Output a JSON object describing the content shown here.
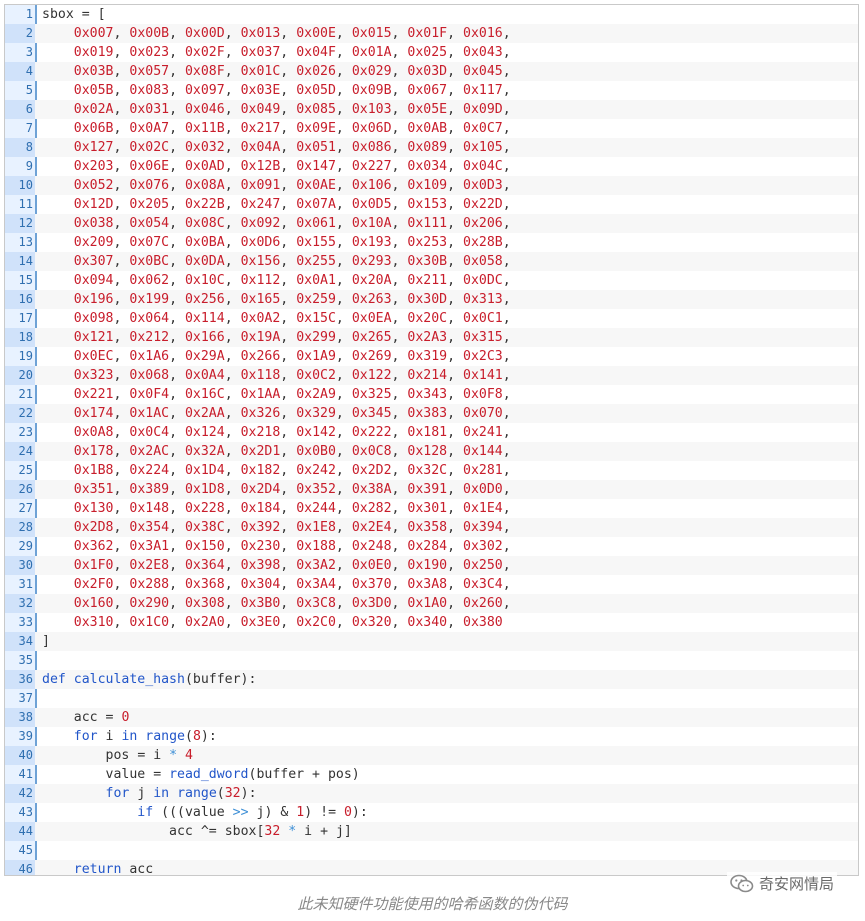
{
  "code_lines": [
    "sbox = [",
    "    0x007, 0x00B, 0x00D, 0x013, 0x00E, 0x015, 0x01F, 0x016,",
    "    0x019, 0x023, 0x02F, 0x037, 0x04F, 0x01A, 0x025, 0x043,",
    "    0x03B, 0x057, 0x08F, 0x01C, 0x026, 0x029, 0x03D, 0x045,",
    "    0x05B, 0x083, 0x097, 0x03E, 0x05D, 0x09B, 0x067, 0x117,",
    "    0x02A, 0x031, 0x046, 0x049, 0x085, 0x103, 0x05E, 0x09D,",
    "    0x06B, 0x0A7, 0x11B, 0x217, 0x09E, 0x06D, 0x0AB, 0x0C7,",
    "    0x127, 0x02C, 0x032, 0x04A, 0x051, 0x086, 0x089, 0x105,",
    "    0x203, 0x06E, 0x0AD, 0x12B, 0x147, 0x227, 0x034, 0x04C,",
    "    0x052, 0x076, 0x08A, 0x091, 0x0AE, 0x106, 0x109, 0x0D3,",
    "    0x12D, 0x205, 0x22B, 0x247, 0x07A, 0x0D5, 0x153, 0x22D,",
    "    0x038, 0x054, 0x08C, 0x092, 0x061, 0x10A, 0x111, 0x206,",
    "    0x209, 0x07C, 0x0BA, 0x0D6, 0x155, 0x193, 0x253, 0x28B,",
    "    0x307, 0x0BC, 0x0DA, 0x156, 0x255, 0x293, 0x30B, 0x058,",
    "    0x094, 0x062, 0x10C, 0x112, 0x0A1, 0x20A, 0x211, 0x0DC,",
    "    0x196, 0x199, 0x256, 0x165, 0x259, 0x263, 0x30D, 0x313,",
    "    0x098, 0x064, 0x114, 0x0A2, 0x15C, 0x0EA, 0x20C, 0x0C1,",
    "    0x121, 0x212, 0x166, 0x19A, 0x299, 0x265, 0x2A3, 0x315,",
    "    0x0EC, 0x1A6, 0x29A, 0x266, 0x1A9, 0x269, 0x319, 0x2C3,",
    "    0x323, 0x068, 0x0A4, 0x118, 0x0C2, 0x122, 0x214, 0x141,",
    "    0x221, 0x0F4, 0x16C, 0x1AA, 0x2A9, 0x325, 0x343, 0x0F8,",
    "    0x174, 0x1AC, 0x2AA, 0x326, 0x329, 0x345, 0x383, 0x070,",
    "    0x0A8, 0x0C4, 0x124, 0x218, 0x142, 0x222, 0x181, 0x241,",
    "    0x178, 0x2AC, 0x32A, 0x2D1, 0x0B0, 0x0C8, 0x128, 0x144,",
    "    0x1B8, 0x224, 0x1D4, 0x182, 0x242, 0x2D2, 0x32C, 0x281,",
    "    0x351, 0x389, 0x1D8, 0x2D4, 0x352, 0x38A, 0x391, 0x0D0,",
    "    0x130, 0x148, 0x228, 0x184, 0x244, 0x282, 0x301, 0x1E4,",
    "    0x2D8, 0x354, 0x38C, 0x392, 0x1E8, 0x2E4, 0x358, 0x394,",
    "    0x362, 0x3A1, 0x150, 0x230, 0x188, 0x248, 0x284, 0x302,",
    "    0x1F0, 0x2E8, 0x364, 0x398, 0x3A2, 0x0E0, 0x190, 0x250,",
    "    0x2F0, 0x288, 0x368, 0x304, 0x3A4, 0x370, 0x3A8, 0x3C4,",
    "    0x160, 0x290, 0x308, 0x3B0, 0x3C8, 0x3D0, 0x1A0, 0x260,",
    "    0x310, 0x1C0, 0x2A0, 0x3E0, 0x2C0, 0x320, 0x340, 0x380",
    "]",
    "",
    "def calculate_hash(buffer):",
    "",
    "    acc = 0",
    "    for i in range(8):",
    "        pos = i * 4",
    "        value = read_dword(buffer + pos)",
    "        for j in range(32):",
    "            if (((value >> j) & 1) != 0):",
    "                acc ^= sbox[32 * i + j]",
    "",
    "    return acc"
  ],
  "caption": "此未知硬件功能使用的哈希函数的伪代码",
  "watermark": {
    "icon": "wechat-icon",
    "text": "奇安网情局"
  },
  "colors": {
    "keyword": "#2256c9",
    "number": "#c81d2b",
    "operator": "#3d8fd6",
    "text": "#333333",
    "gutter_bg": "#e8f2ff",
    "gutter_number": "#2f6fb0"
  }
}
